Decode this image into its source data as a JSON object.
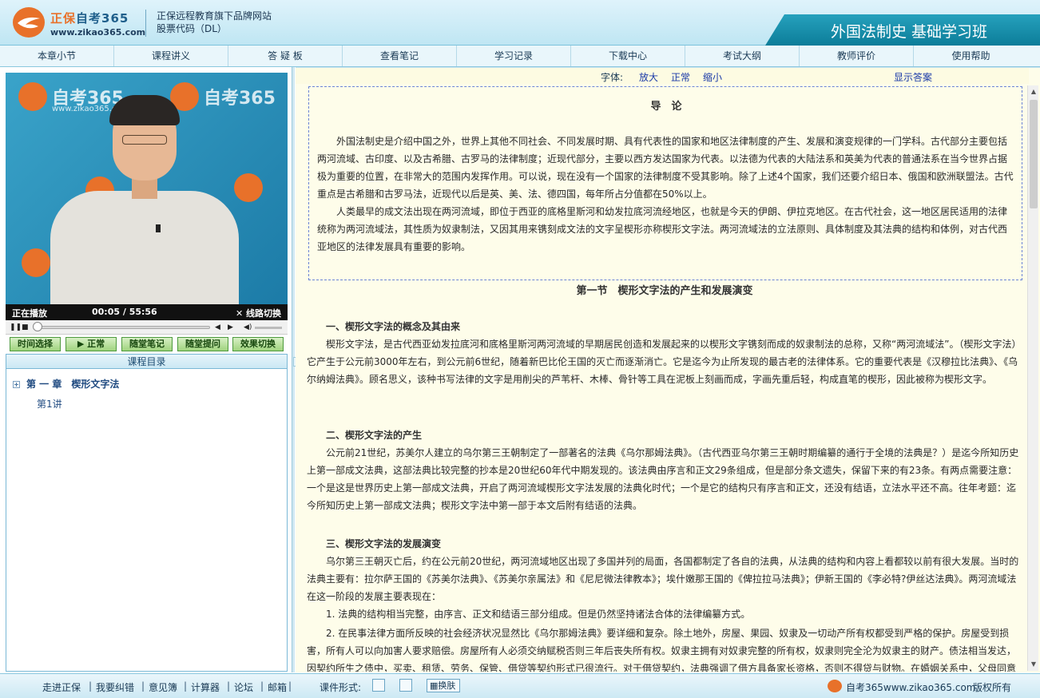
{
  "header": {
    "brand_part1": "正保",
    "brand_part2": "自考365",
    "brand_url": "www.zikao365.com",
    "tagline_line1": "正保远程教育旗下品牌网站",
    "tagline_line2": "股票代码（DL）",
    "course_title": "外国法制史 基础学习班"
  },
  "nav": [
    {
      "label": "本章小节"
    },
    {
      "label": "课程讲义"
    },
    {
      "label": "答 疑 板"
    },
    {
      "label": "查看笔记"
    },
    {
      "label": "学习记录"
    },
    {
      "label": "下载中心"
    },
    {
      "label": "考试大纲"
    },
    {
      "label": "教师评价"
    },
    {
      "label": "使用帮助"
    }
  ],
  "video": {
    "watermark_brand": "自考365",
    "watermark_url": "www.zikao365.com",
    "status": "正在播放",
    "time": "00:05 / 55:56",
    "switch_label": "线路切换",
    "progress": 0.0015
  },
  "buttons": [
    {
      "label": "时间选择"
    },
    {
      "label": "▶ 正常"
    },
    {
      "label": "随堂笔记"
    },
    {
      "label": "随堂提问"
    },
    {
      "label": "效果切换"
    }
  ],
  "catalog": {
    "title": "课程目录",
    "chapter": "第 一 章　楔形文字法",
    "lesson": "第1讲"
  },
  "toolbar": {
    "font_label": "字体:",
    "enlarge": "放大",
    "normal": "正常",
    "shrink": "缩小",
    "show_answer": "显示答案"
  },
  "doc": {
    "intro_title": "导　论",
    "intro_p1": "外国法制史是介绍中国之外，世界上其他不同社会、不同发展时期、具有代表性的国家和地区法律制度的产生、发展和演变规律的一门学科。古代部分主要包括两河流域、古印度、以及古希腊、古罗马的法律制度；近现代部分，主要以西方发达国家为代表。以法德为代表的大陆法系和英美为代表的普通法系在当今世界占据极为重要的位置，在非常大的范围内发挥作用。可以说，现在没有一个国家的法律制度不受其影响。除了上述4个国家，我们还要介绍日本、俄国和欧洲联盟法。古代重点是古希腊和古罗马法，近现代以后是英、美、法、德四国，每年所占分值都在50%以上。",
    "intro_p2": "人类最早的成文法出现在两河流域，即位于西亚的底格里斯河和幼发拉底河流经地区，也就是今天的伊朗、伊拉克地区。在古代社会，这一地区居民适用的法律统称为两河流域法，其性质为奴隶制法，又因其用来镌刻成文法的文字呈楔形亦称楔形文字法。两河流域法的立法原则、具体制度及其法典的结构和体例，对古代西亚地区的法律发展具有重要的影响。",
    "section_title": "第一节　楔形文字法的产生和发展演变",
    "h1": "一、楔形文字法的概念及其由来",
    "p1": "楔形文字法，是古代西亚幼发拉底河和底格里斯河两河流域的早期居民创造和发展起来的以楔形文字镌刻而成的奴隶制法的总称，又称“两河流域法”。（楔形文字法）它产生于公元前3000年左右，到公元前6世纪，随着新巴比伦王国的灭亡而逐渐消亡。它是迄今为止所发现的最古老的法律体系。它的重要代表是《汉穆拉比法典》、《乌尔纳姆法典》。顾名思义，该种书写法律的文字是用削尖的芦苇杆、木棒、骨针等工具在泥板上刻画而成，字画先重后轻，构成直笔的楔形，因此被称为楔形文字。",
    "h2": "二、楔形文字法的产生",
    "p2": "公元前21世纪，苏美尔人建立的乌尔第三王朝制定了一部著名的法典《乌尔那姆法典》。（古代西亚乌尔第三王朝时期编纂的通行于全境的法典是？）是迄今所知历史上第一部成文法典，这部法典比较完整的抄本是20世纪60年代中期发现的。该法典由序言和正文29条组成，但是部分条文遗失，保留下来的有23条。有两点需要注意：一个是这是世界历史上第一部成文法典，开启了两河流域楔形文字法发展的法典化时代；一个是它的结构只有序言和正文，还没有结语，立法水平还不高。往年考题：迄今所知历史上第一部成文法典；楔形文字法中第一部于本文后附有结语的法典。",
    "h3": "三、楔形文字法的发展演变",
    "p3": "乌尔第三王朝灭亡后，约在公元前20世纪，两河流域地区出现了多国并列的局面，各国都制定了各自的法典，从法典的结构和内容上看都较以前有很大发展。当时的法典主要有：拉尔萨王国的《苏美尔法典》、《苏美尔亲属法》和《尼尼微法律教本》；埃什嫩那王国的《俾拉拉马法典》；伊新王国的《李必特?伊丝达法典》。两河流域法在这一阶段的发展主要表现在：",
    "li1": "1. 法典的结构相当完整，由序言、正文和结语三部分组成。但是仍然坚持诸法合体的法律编纂方式。",
    "li2": "2. 在民事法律方面所反映的社会经济状况显然比《乌尔那姆法典》要详细和复杂。除土地外，房屋、果园、奴隶及一切动产所有权都受到严格的保护。房屋受到损害，所有人可以向加害人要求赔偿。房屋所有人必须交纳赋税否则三年后丧失所有权。奴隶主拥有对奴隶完整的所有权，奴隶则完全沦为奴隶主的财产。债法相当发达，因契约所生之债中，买卖、租赁、劳务、保管、借贷等契约形式已很流行。对于借贷契约，法典强调了借方具备家长资格，否则不得贷与财物。在婚姻关系中，父母同意"
  },
  "footer": {
    "links": [
      "走进正保",
      "我要纠错",
      "意见簿",
      "计算器",
      "论坛",
      "邮箱"
    ],
    "format_label": "课件形式:",
    "skin_label": "换肤",
    "site": "自考365www.zikao365.com",
    "copyright": "版权所有"
  }
}
